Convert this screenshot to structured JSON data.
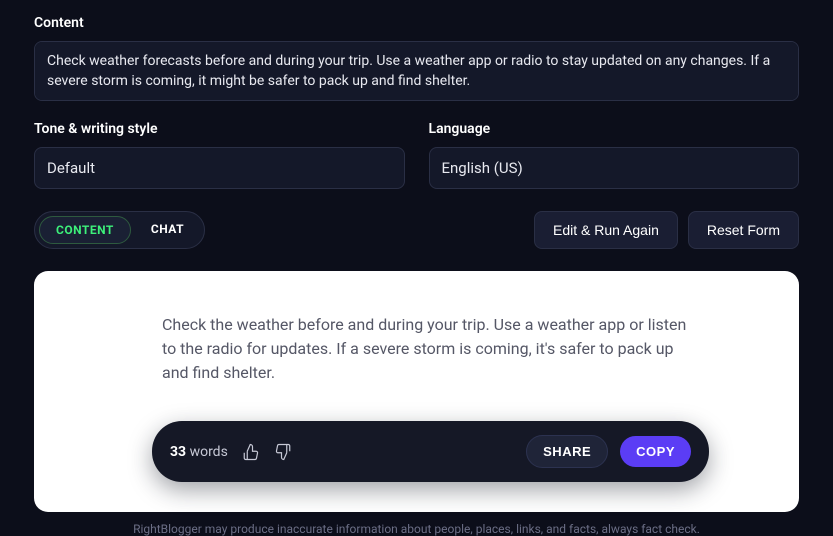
{
  "labels": {
    "content": "Content",
    "tone": "Tone & writing style",
    "language": "Language"
  },
  "fields": {
    "content_value": "Check weather forecasts before and during your trip. Use a weather app or radio to stay updated on any changes. If a severe storm is coming, it might be safer to pack up and find shelter.",
    "tone_value": "Default",
    "language_value": "English (US)"
  },
  "tabs": {
    "content": "CONTENT",
    "chat": "CHAT"
  },
  "buttons": {
    "edit_run": "Edit & Run Again",
    "reset": "Reset Form",
    "share": "SHARE",
    "copy": "COPY"
  },
  "result": {
    "text": "Check the weather before and during your trip. Use a weather app or listen to the radio for updates. If a severe storm is coming, it's safer to pack up and find shelter.",
    "word_count": "33",
    "word_label": "words"
  },
  "disclaimer": "RightBlogger may produce inaccurate information about people, places, links, and facts, always fact check."
}
